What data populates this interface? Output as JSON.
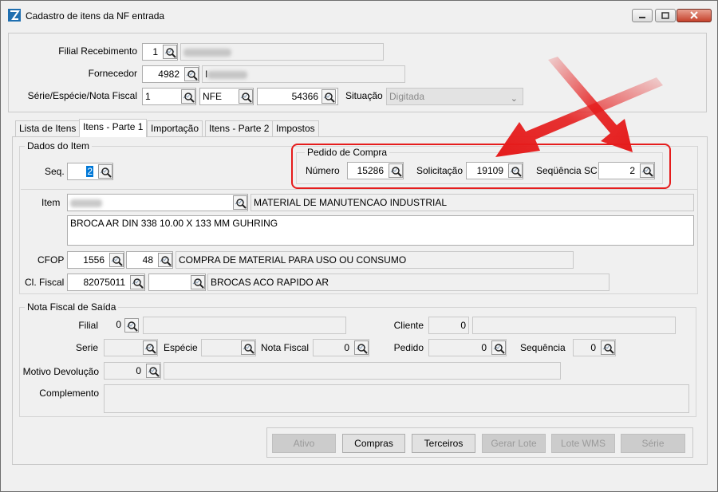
{
  "window": {
    "title": "Cadastro de itens da NF entrada"
  },
  "header": {
    "filial_label": "Filial Recebimento",
    "filial_value": "1",
    "fornecedor_label": "Fornecedor",
    "fornecedor_value": "4982",
    "fornecedor_name_initial": "I",
    "serie_label": "Série/Espécie/Nota Fiscal",
    "serie_value": "1",
    "especie_value": "NFE",
    "nota_value": "54366",
    "situacao_label": "Situação",
    "situacao_value": "Digitada"
  },
  "tabs": [
    "Lista de Itens",
    "Itens - Parte 1",
    "Importação",
    "Itens - Parte 2",
    "Impostos"
  ],
  "dados_item": {
    "group_label": "Dados do Item",
    "seq_label": "Seq.",
    "seq_value": "2",
    "pedido_group_label": "Pedido de Compra",
    "numero_label": "Número",
    "numero_value": "15286",
    "solicitacao_label": "Solicitação",
    "solicitacao_value": "19109",
    "seq_sc_label": "Seqüência SC",
    "seq_sc_value": "2",
    "item_label": "Item",
    "item_desc": "MATERIAL DE MANUTENCAO INDUSTRIAL",
    "item_complement": "BROCA AR DIN 338 10.00 X 133 MM GUHRING",
    "cfop_label": "CFOP",
    "cfop_value": "1556",
    "cfop_seq": "48",
    "cfop_desc": "COMPRA DE MATERIAL PARA USO OU CONSUMO",
    "clfiscal_label": "Cl. Fiscal",
    "clfiscal_value": "82075011",
    "clfiscal_desc": "BROCAS ACO RAPIDO AR"
  },
  "nf_saida": {
    "group_label": "Nota Fiscal de Saída",
    "filial_label": "Filial",
    "filial_value": "0",
    "cliente_label": "Cliente",
    "cliente_value": "0",
    "serie_label": "Serie",
    "especie_label": "Espécie",
    "nota_label": "Nota Fiscal",
    "nota_value": "0",
    "pedido_label": "Pedido",
    "pedido_value": "0",
    "sequencia_label": "Sequência",
    "sequencia_value": "0",
    "motivo_label": "Motivo Devolução",
    "motivo_value": "0",
    "complemento_label": "Complemento"
  },
  "buttons": {
    "ativo": "Ativo",
    "compras": "Compras",
    "terceiros": "Terceiros",
    "gerar_lote": "Gerar Lote",
    "lote_wms": "Lote WMS",
    "serie": "Série"
  },
  "colors": {
    "annotation": "#e51c1c"
  }
}
